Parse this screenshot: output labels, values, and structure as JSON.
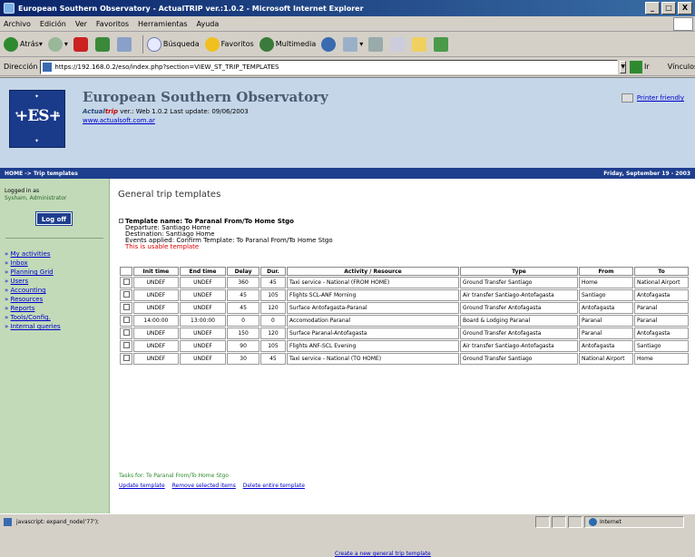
{
  "window": {
    "title": "European Southern Observatory - ActualTRIP ver.:1.0.2 - Microsoft Internet Explorer",
    "minimize": "_",
    "maximize": "□",
    "close": "X"
  },
  "menubar": [
    "Archivo",
    "Edición",
    "Ver",
    "Favoritos",
    "Herramientas",
    "Ayuda"
  ],
  "toolbar": {
    "back": "Atrás",
    "search": "Búsqueda",
    "favorites": "Favoritos",
    "multimedia": "Multimedia"
  },
  "address": {
    "label": "Dirección",
    "url": "https://192.168.0.2/eso/index.php?section=VIEW_ST_TRIP_TEMPLATES",
    "go": "Ir",
    "links": "Vínculos"
  },
  "header": {
    "site_title": "European Southern Observatory",
    "brand_a": "Actual",
    "brand_b": "trip",
    "version_text": " ver.: Web 1.0.2 Last update: 09/06/2003",
    "site_link": "www.actualsoft.com.ar",
    "printer_friendly": "Printer friendly"
  },
  "nav": {
    "breadcrumb": "HOME -> Trip templates",
    "date": "Friday, September 19 - 2003"
  },
  "sidebar": {
    "logged_in_label": "Logged in as",
    "user": "Sysham, Administrator",
    "logoff": "Log off",
    "menu": [
      "My activities",
      "Inbox",
      "Planning Grid",
      "Users",
      "Accounting",
      "Resources",
      "Reports",
      "Tools/Config.",
      "Internal queries"
    ]
  },
  "main": {
    "title": "General trip templates",
    "template_name": "Template name: To Paranal From/To Home Stgo",
    "departure": "Departure: Santiago Home",
    "destination": "Destination: Santiago Home",
    "events_applied": "Events applied: Confirm Template: To Paranal From/To Home Stgo",
    "usable_note": "This is usable template",
    "columns": [
      "",
      "Init time",
      "End time",
      "Delay",
      "Dur.",
      "Activity / Resource",
      "Type",
      "From",
      "To"
    ],
    "rows": [
      [
        "UNDEF",
        "UNDEF",
        "360",
        "45",
        "Taxi service - National (FROM HOME)",
        "Ground Transfer Santiago",
        "Home",
        "National Airport"
      ],
      [
        "UNDEF",
        "UNDEF",
        "45",
        "105",
        "Flights SCL-ANF Morning",
        "Air transfer Santiago-Antofagasta",
        "Santiago",
        "Antofagasta"
      ],
      [
        "UNDEF",
        "UNDEF",
        "45",
        "120",
        "Surface Antofagasta-Paranal",
        "Ground Transfer Antofagasta",
        "Antofagasta",
        "Paranal"
      ],
      [
        "14:00:00",
        "13:00:00",
        "0",
        "0",
        "Accomodation Paranal",
        "Board & Lodging Paranal",
        "Paranal",
        "Paranal"
      ],
      [
        "UNDEF",
        "UNDEF",
        "150",
        "120",
        "Surface Paranal-Antofagasta",
        "Ground Transfer Antofagasta",
        "Paranal",
        "Antofagasta"
      ],
      [
        "UNDEF",
        "UNDEF",
        "90",
        "105",
        "Flights ANF-SCL Evening",
        "Air transfer Santiago-Antofagasta",
        "Antofagasta",
        "Santiago"
      ],
      [
        "UNDEF",
        "UNDEF",
        "30",
        "45",
        "Taxi service - National (TO HOME)",
        "Ground Transfer Santiago",
        "National Airport",
        "Home"
      ]
    ],
    "tasks": "Tasks for: To Paranal From/To Home Stgo",
    "update_template": "Update template",
    "remove_items": "Remove selected items",
    "delete_template": "Delete entire template",
    "create_new": "Create a new general trip template"
  },
  "status": {
    "text": "javascript: expand_node('77');",
    "zone": "Internet"
  }
}
